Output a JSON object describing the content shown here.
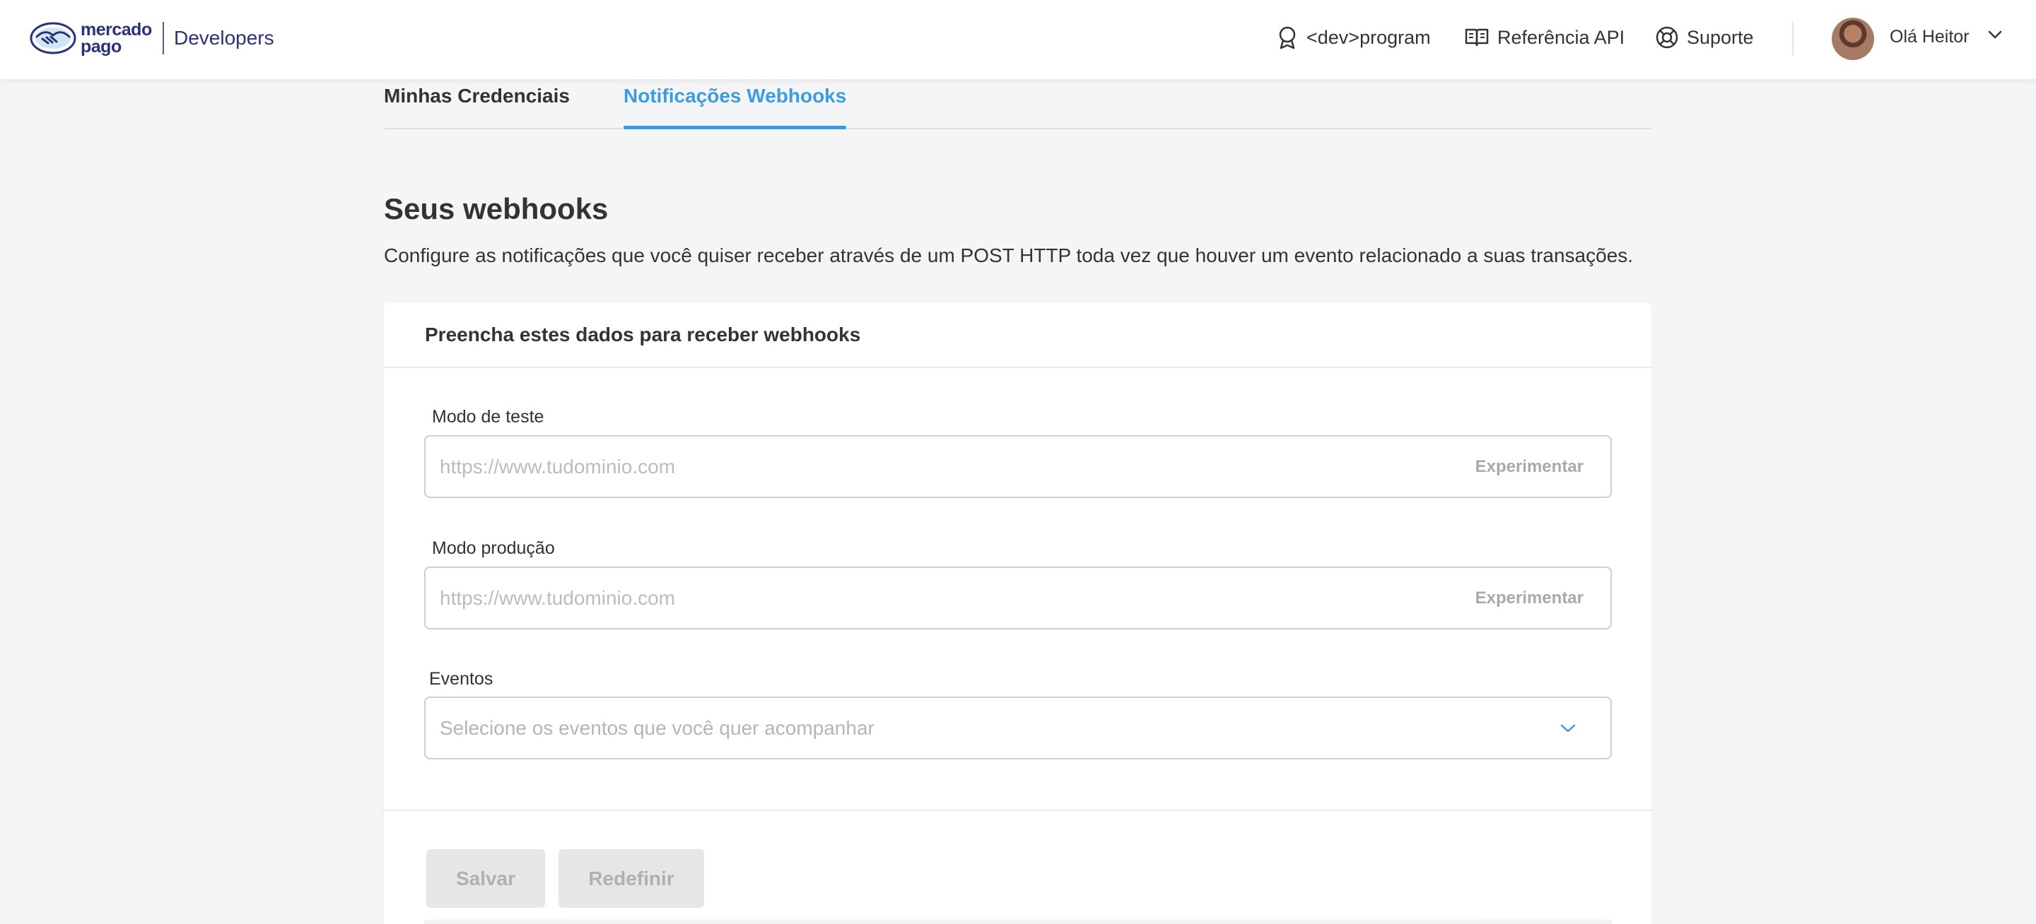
{
  "header": {
    "brand_word": "mercado pago",
    "brand_product": "Developers",
    "nav": {
      "dev_program": "<dev>program",
      "api_reference": "Referência API",
      "support": "Suporte"
    },
    "user_greeting": "Olá Heitor"
  },
  "tabs": [
    {
      "label": "Minhas Credenciais",
      "active": false
    },
    {
      "label": "Notificações Webhooks",
      "active": true
    }
  ],
  "page": {
    "title": "Seus webhooks",
    "description": "Configure as notificações que você quiser receber através de um POST HTTP toda vez que houver um evento relacionado a suas transações."
  },
  "form": {
    "card_title": "Preencha estes dados para receber webhooks",
    "test_mode": {
      "label": "Modo de teste",
      "placeholder": "https://www.tudominio.com",
      "value": "",
      "action": "Experimentar"
    },
    "production_mode": {
      "label": "Modo produção",
      "placeholder": "https://www.tudominio.com",
      "value": "",
      "action": "Experimentar"
    },
    "events": {
      "label": "Eventos",
      "placeholder": "Selecione os eventos que você quer acompanhar"
    },
    "save_label": "Salvar",
    "reset_label": "Redefinir"
  },
  "colors": {
    "accent": "#3d9be0",
    "brand": "#2d3277",
    "background": "#f4f5f7",
    "disabled_button": "#e6e6e6"
  },
  "icons": {
    "dev_program": "badge-icon",
    "api_reference": "book-icon",
    "support": "lifebuoy-icon",
    "user_menu": "chevron-down-icon",
    "events_select": "chevron-down-icon"
  }
}
